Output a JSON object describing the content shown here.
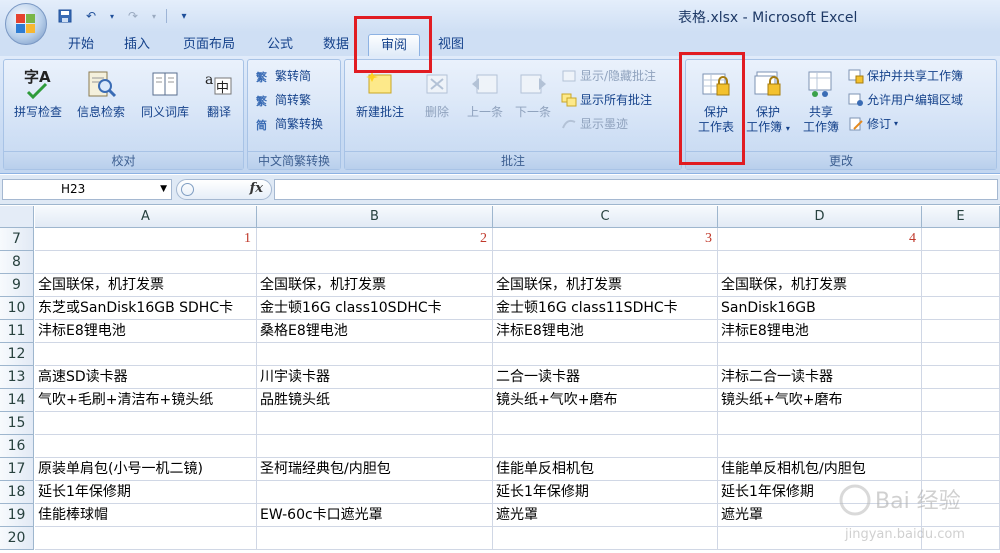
{
  "window": {
    "title": "表格.xlsx - Microsoft Excel"
  },
  "qat": {
    "icons": [
      "save-icon",
      "undo-icon",
      "redo-icon",
      "customize-icon"
    ]
  },
  "tabs": [
    {
      "label": "开始"
    },
    {
      "label": "插入"
    },
    {
      "label": "页面布局"
    },
    {
      "label": "公式"
    },
    {
      "label": "数据"
    },
    {
      "label": "审阅",
      "active": true
    },
    {
      "label": "视图"
    }
  ],
  "ribbon": {
    "proofing": {
      "label": "校对",
      "buttons": [
        "拼写检查",
        "信息检索",
        "同义词库",
        "翻译"
      ],
      "icon_text": "字A"
    },
    "chinese": {
      "label": "中文简繁转换",
      "buttons": [
        "繁转简",
        "简转繁",
        "简繁转换"
      ],
      "icon_text": [
        "繁",
        "繁",
        "简"
      ]
    },
    "comments": {
      "label": "批注",
      "new": "新建批注",
      "delete": "删除",
      "prev": "上一条",
      "next": "下一条",
      "show_hide": "显示/隐藏批注",
      "show_all": "显示所有批注",
      "show_ink": "显示墨迹"
    },
    "changes": {
      "label": "更改",
      "protect_sheet": [
        "保护",
        "工作表"
      ],
      "protect_book": [
        "保护",
        "工作簿"
      ],
      "share_book": [
        "共享",
        "工作簿"
      ],
      "protect_share": "保护并共享工作簿",
      "allow_edit": "允许用户编辑区域",
      "track": "修订"
    }
  },
  "formula_bar": {
    "name_box": "H23",
    "fx": "fx",
    "value": ""
  },
  "grid": {
    "columns": [
      "A",
      "B",
      "C",
      "D",
      "E"
    ],
    "rows": [
      {
        "num": "7",
        "cells": [
          "1",
          "2",
          "3",
          "4",
          ""
        ],
        "numeric": true
      },
      {
        "num": "8",
        "cells": [
          "",
          "",
          "",
          "",
          ""
        ]
      },
      {
        "num": "9",
        "cells": [
          "全国联保，机打发票",
          "全国联保，机打发票",
          "全国联保，机打发票",
          "全国联保，机打发票",
          ""
        ]
      },
      {
        "num": "10",
        "cells": [
          "东芝或SanDisk16GB SDHC卡",
          "金士顿16G class10SDHC卡",
          "金士顿16G class11SDHC卡",
          "SanDisk16GB",
          ""
        ]
      },
      {
        "num": "11",
        "cells": [
          "沣标E8锂电池",
          "桑格E8锂电池",
          "沣标E8锂电池",
          "沣标E8锂电池",
          ""
        ]
      },
      {
        "num": "12",
        "cells": [
          "",
          "",
          "",
          "",
          ""
        ]
      },
      {
        "num": "13",
        "cells": [
          "高速SD读卡器",
          "川宇读卡器",
          "二合一读卡器",
          "沣标二合一读卡器",
          ""
        ]
      },
      {
        "num": "14",
        "cells": [
          "气吹+毛刷+清洁布+镜头纸",
          "品胜镜头纸",
          "镜头纸+气吹+磨布",
          "镜头纸+气吹+磨布",
          ""
        ]
      },
      {
        "num": "15",
        "cells": [
          "",
          "",
          "",
          "",
          ""
        ]
      },
      {
        "num": "16",
        "cells": [
          "",
          "",
          "",
          "",
          ""
        ]
      },
      {
        "num": "17",
        "cells": [
          "原装单肩包(小号一机二镜)",
          "圣柯瑞经典包/内胆包",
          "佳能单反相机包",
          "佳能单反相机包/内胆包",
          ""
        ]
      },
      {
        "num": "18",
        "cells": [
          "延长1年保修期",
          "",
          "延长1年保修期",
          "延长1年保修期",
          ""
        ]
      },
      {
        "num": "19",
        "cells": [
          "佳能棒球帽",
          "EW-60c卡口遮光罩",
          "遮光罩",
          "遮光罩",
          ""
        ]
      },
      {
        "num": "20",
        "cells": [
          "",
          "",
          "",
          "",
          ""
        ]
      }
    ]
  },
  "watermark": {
    "text": "Bai 经验",
    "url": "jingyan.baidu.com"
  },
  "colors": {
    "highlight": "#e11c22",
    "accent": "#15428b"
  }
}
